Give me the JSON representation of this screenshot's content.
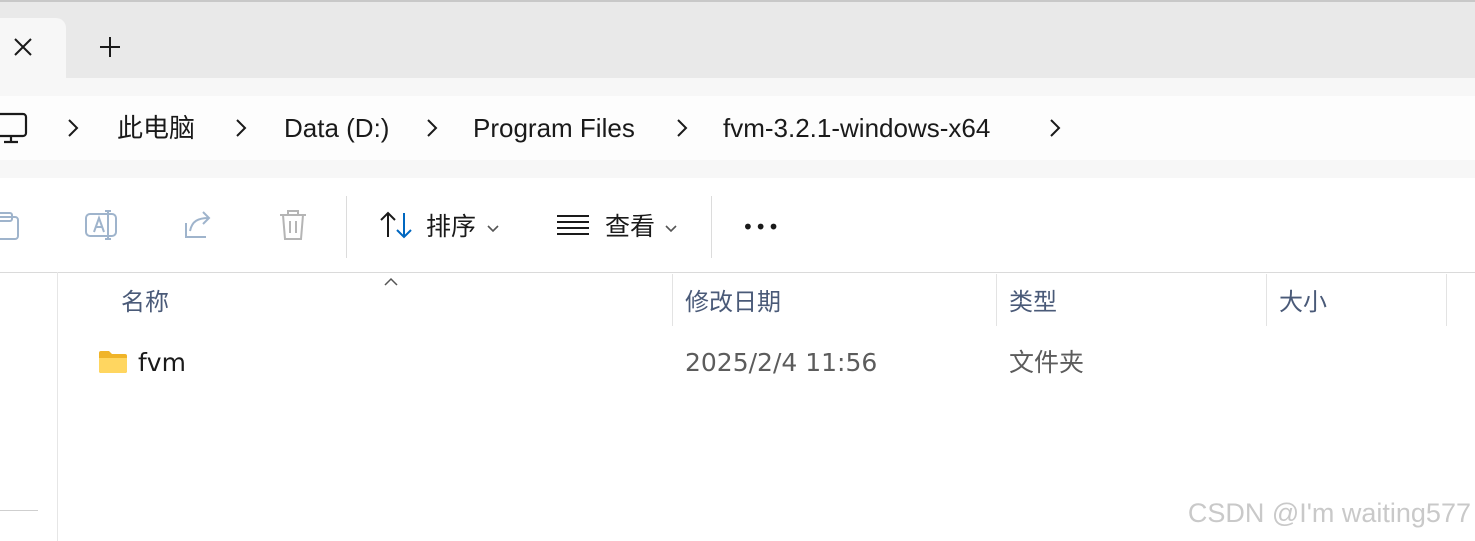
{
  "tabs": {
    "new_tab_symbol": "+"
  },
  "breadcrumb": {
    "items": [
      {
        "label": "此电脑"
      },
      {
        "label": "Data (D:)"
      },
      {
        "label": "Program Files"
      },
      {
        "label": "fvm-3.2.1-windows-x64"
      }
    ]
  },
  "toolbar": {
    "sort_label": "排序",
    "view_label": "查看",
    "more_label": "•••"
  },
  "file_list": {
    "columns": [
      "名称",
      "修改日期",
      "类型",
      "大小"
    ],
    "sorted_column": "名称",
    "rows": [
      {
        "name": "fvm",
        "modified": "2025/2/4 11:56",
        "type": "文件夹",
        "size": ""
      }
    ]
  },
  "watermark": "CSDN @I'm waiting577",
  "colors": {
    "accent": "#0067c0",
    "folder": "#f5c84c",
    "header_text": "#4a5a78"
  }
}
